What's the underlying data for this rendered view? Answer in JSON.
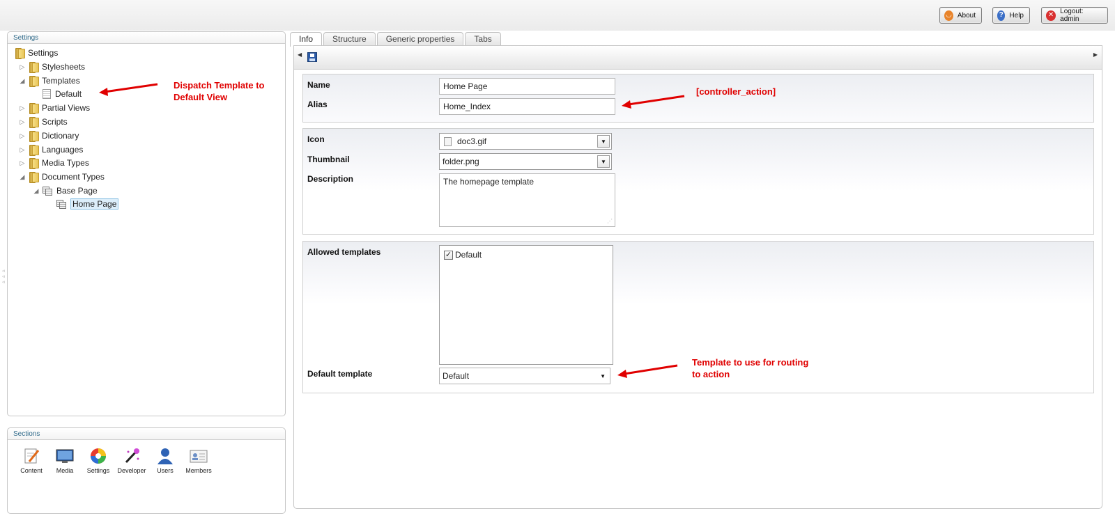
{
  "header": {
    "about_label": "About",
    "help_label": "Help",
    "logout_label": "Logout: admin"
  },
  "settings_tree": {
    "title": "Settings",
    "root": "Settings",
    "items": [
      {
        "label": "Stylesheets"
      },
      {
        "label": "Templates"
      },
      {
        "label": "Default"
      },
      {
        "label": "Partial Views"
      },
      {
        "label": "Scripts"
      },
      {
        "label": "Dictionary"
      },
      {
        "label": "Languages"
      },
      {
        "label": "Media Types"
      },
      {
        "label": "Document Types"
      },
      {
        "label": "Base Page"
      },
      {
        "label": "Home Page"
      }
    ]
  },
  "annotations": {
    "dispatch_line1": "Dispatch Template to",
    "dispatch_line2": "Default View",
    "controller_action": "[controller_action]",
    "template_line1": "Template to use for routing",
    "template_line2": "to action"
  },
  "sections": {
    "title": "Sections",
    "items": [
      {
        "label": "Content",
        "icon": "pencil-document-icon"
      },
      {
        "label": "Media",
        "icon": "monitor-image-icon"
      },
      {
        "label": "Settings",
        "icon": "color-wheel-icon"
      },
      {
        "label": "Developer",
        "icon": "magic-wand-icon"
      },
      {
        "label": "Users",
        "icon": "user-icon"
      },
      {
        "label": "Members",
        "icon": "member-card-icon"
      }
    ]
  },
  "tabs": [
    {
      "label": "Info",
      "active": true
    },
    {
      "label": "Structure"
    },
    {
      "label": "Generic properties"
    },
    {
      "label": "Tabs"
    }
  ],
  "form": {
    "name_label": "Name",
    "name_value": "Home Page",
    "alias_label": "Alias",
    "alias_value": "Home_Index",
    "icon_label": "Icon",
    "icon_value": "doc3.gif",
    "thumbnail_label": "Thumbnail",
    "thumbnail_value": "folder.png",
    "description_label": "Description",
    "description_value": "The homepage template",
    "allowed_templates_label": "Allowed templates",
    "allowed_templates": [
      {
        "label": "Default",
        "checked": true
      }
    ],
    "default_template_label": "Default template",
    "default_template_value": "Default"
  },
  "colors": {
    "annotation": "#e00000",
    "panel_title": "#2f6a8a",
    "selection_bg": "#dceefa"
  }
}
